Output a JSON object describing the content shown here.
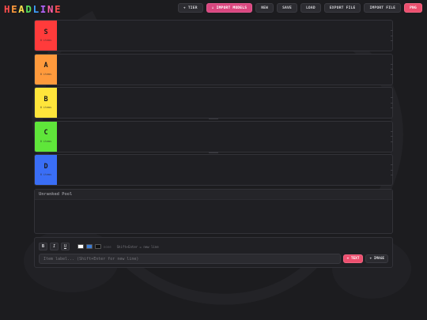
{
  "app": {
    "logo_letters": [
      {
        "char": "H",
        "color": "#ff4d4d"
      },
      {
        "char": "E",
        "color": "#ff9a3c"
      },
      {
        "char": "A",
        "color": "#ffe14d"
      },
      {
        "char": "D",
        "color": "#59e05c"
      },
      {
        "char": "L",
        "color": "#3ea0ff"
      },
      {
        "char": "I",
        "color": "#b565ff"
      },
      {
        "char": "N",
        "color": "#ff5fa8"
      },
      {
        "char": "E",
        "color": "#ff4d4d"
      }
    ]
  },
  "toolbar": {
    "tier_label": "+ TIER",
    "import_models_label": "↓ IMPORT MODELS",
    "new_label": "NEW",
    "save_label": "SAVE",
    "load_label": "LOAD",
    "export_file_label": "EXPORT FILE",
    "import_file_label": "IMPORT FILE",
    "png_label": "PNG"
  },
  "tiers": [
    {
      "letter": "S",
      "count": "0 items",
      "color": "#ff3b3b"
    },
    {
      "letter": "A",
      "count": "0 items",
      "color": "#ff9a3c"
    },
    {
      "letter": "B",
      "count": "0 items",
      "color": "#ffe53b"
    },
    {
      "letter": "C",
      "count": "0 items",
      "color": "#5fe63a"
    },
    {
      "letter": "D",
      "count": "0 items",
      "color": "#3a6ef5"
    }
  ],
  "pool": {
    "title": "Unranked Pool"
  },
  "editor": {
    "bold": "B",
    "italic": "I",
    "underline": "U",
    "text_color": "#ffffff",
    "highlight_color": "#3a7bd5",
    "bg_color": "#111111",
    "none_label": "none",
    "hint": "Shift+Enter = new line",
    "input_placeholder": "Item label... (Shift+Enter for new line)",
    "add_text_label": "+ TEXT",
    "add_image_label": "+ IMAGE"
  }
}
